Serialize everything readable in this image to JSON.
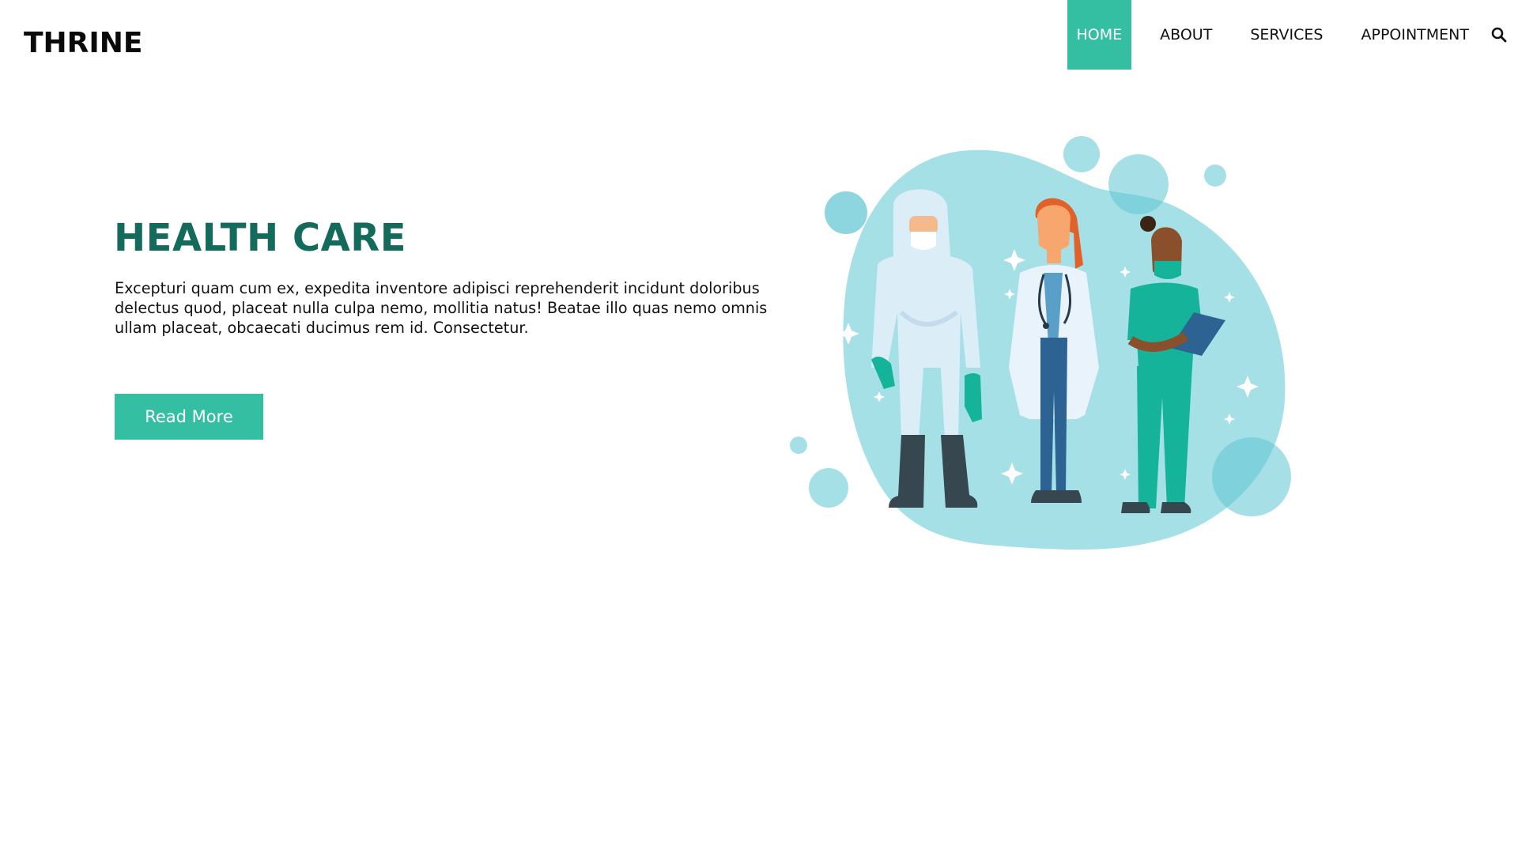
{
  "brand": {
    "logo_text": "THRINE"
  },
  "nav": {
    "items": [
      {
        "label": "HOME",
        "active": true
      },
      {
        "label": "ABOUT",
        "active": false
      },
      {
        "label": "SERVICES",
        "active": false
      },
      {
        "label": "APPOINTMENT",
        "active": false
      }
    ],
    "search_icon": "search-icon"
  },
  "hero": {
    "title": "HEALTH CARE",
    "description": "Excepturi quam cum ex, expedita inventore adipisci reprehenderit incidunt doloribus delectus quod, placeat nulla culpa nemo, mollitia natus! Beatae illo quas nemo omnis ullam placeat, obcaecati ducimus rem id. Consectetur.",
    "button_label": "Read More",
    "illustration_icon": "medical-staff-illustration"
  },
  "colors": {
    "accent": "#34bfa3",
    "title": "#146b5c",
    "blob": "#a6e0e7",
    "bubble": "#5ec4d2"
  }
}
